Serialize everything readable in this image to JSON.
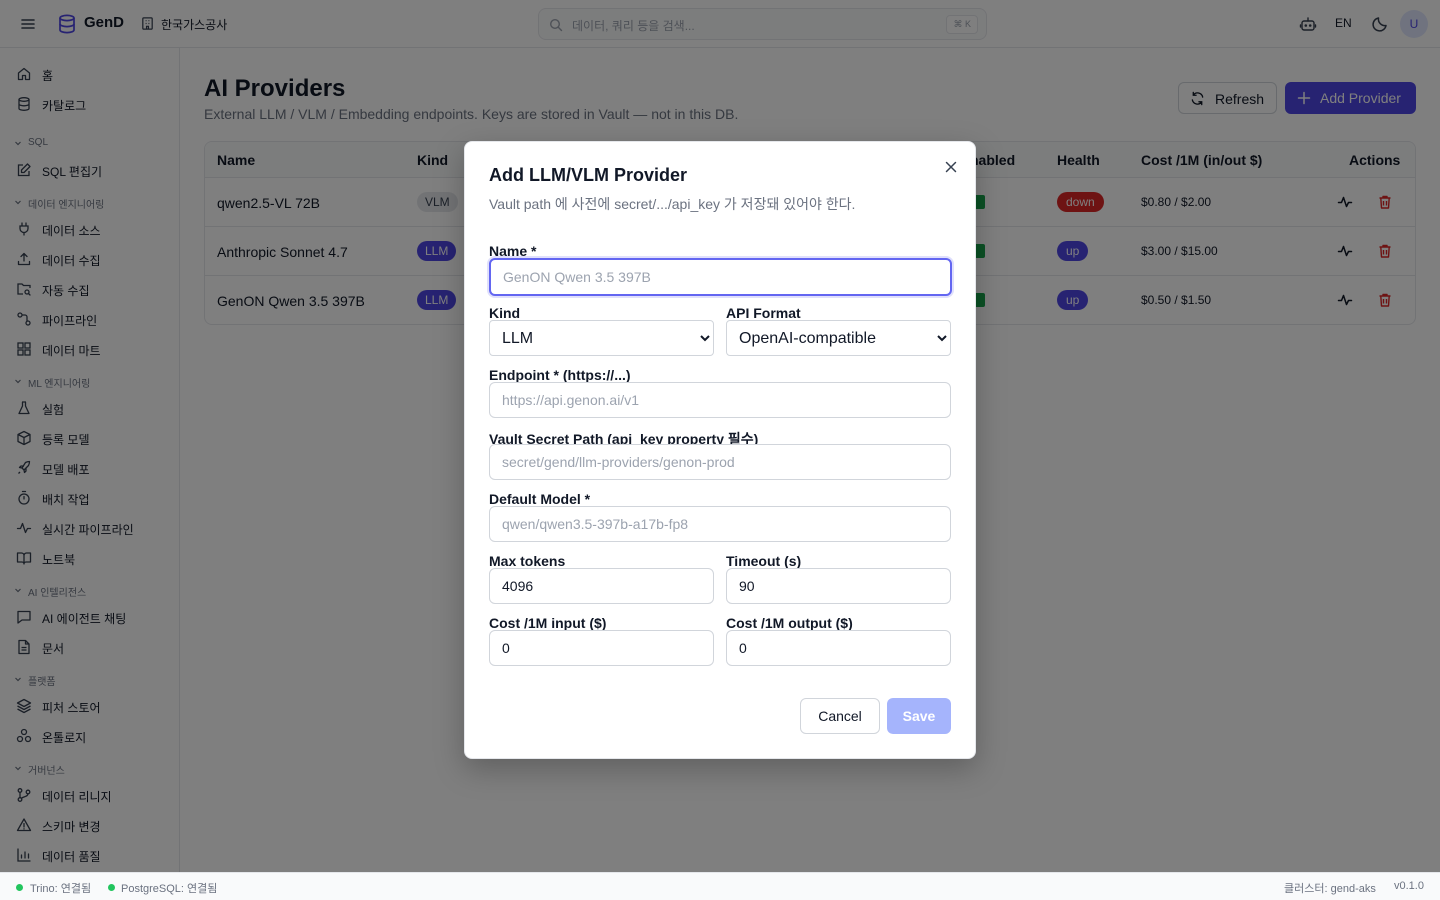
{
  "topbar": {
    "app_name": "GenD",
    "org_name": "한국가스공사",
    "search_placeholder": "데이터, 쿼리 등을 검색...",
    "search_shortcut": "⌘ K",
    "language": "EN",
    "avatar_initial": "U"
  },
  "sidebar": {
    "top_items": [
      {
        "label": "홈",
        "icon": "home-icon"
      },
      {
        "label": "카탈로그",
        "icon": "database-icon"
      }
    ],
    "sections": [
      {
        "title": "SQL",
        "items": [
          {
            "label": "SQL 편집기",
            "icon": "edit-icon"
          }
        ]
      },
      {
        "title": "데이터 엔지니어링",
        "items": [
          {
            "label": "데이터 소스",
            "icon": "plug-icon"
          },
          {
            "label": "데이터 수집",
            "icon": "upload-icon"
          },
          {
            "label": "자동 수집",
            "icon": "folder-search-icon"
          },
          {
            "label": "파이프라인",
            "icon": "workflow-icon"
          },
          {
            "label": "데이터 마트",
            "icon": "grid-icon"
          }
        ]
      },
      {
        "title": "ML 엔지니어링",
        "items": [
          {
            "label": "실험",
            "icon": "flask-icon"
          },
          {
            "label": "등록 모델",
            "icon": "package-icon"
          },
          {
            "label": "모델 배포",
            "icon": "rocket-icon"
          },
          {
            "label": "배치 작업",
            "icon": "timer-icon"
          },
          {
            "label": "실시간 파이프라인",
            "icon": "activity-icon"
          },
          {
            "label": "노트북",
            "icon": "book-icon"
          }
        ]
      },
      {
        "title": "AI 인텔리전스",
        "items": [
          {
            "label": "AI 에이전트 채팅",
            "icon": "chat-icon"
          },
          {
            "label": "문서",
            "icon": "file-icon"
          }
        ]
      },
      {
        "title": "플랫폼",
        "items": [
          {
            "label": "피처 스토어",
            "icon": "layers-icon"
          },
          {
            "label": "온톨로지",
            "icon": "ontology-icon"
          }
        ]
      },
      {
        "title": "거버넌스",
        "items": [
          {
            "label": "데이터 리니지",
            "icon": "git-branch-icon"
          },
          {
            "label": "스키마 변경",
            "icon": "warning-icon"
          },
          {
            "label": "데이터 품질",
            "icon": "bar-chart-icon"
          }
        ]
      }
    ]
  },
  "main": {
    "title": "AI Providers",
    "subtitle": "External LLM / VLM / Embedding endpoints. Keys are stored in Vault — not in this DB.",
    "refresh_label": "Refresh",
    "add_label": "Add Provider",
    "table": {
      "headers": {
        "name": "Name",
        "kind": "Kind",
        "enabled": "nabled",
        "health": "Health",
        "cost": "Cost /1M (in/out $)",
        "actions": "Actions"
      },
      "rows": [
        {
          "name": "qwen2.5-VL 72B",
          "kind": "VLM",
          "health": "down",
          "cost": "$0.80 / $2.00"
        },
        {
          "name": "Anthropic Sonnet 4.7",
          "kind": "LLM",
          "health": "up",
          "cost": "$3.00 / $15.00"
        },
        {
          "name": "GenON Qwen 3.5 397B",
          "kind": "LLM",
          "health": "up",
          "cost": "$0.50 / $1.50"
        }
      ]
    }
  },
  "modal": {
    "title": "Add LLM/VLM Provider",
    "description": "Vault path 에 사전에 secret/.../api_key 가 저장돼 있어야 한다.",
    "name_label": "Name *",
    "name_placeholder": "GenON Qwen 3.5 397B",
    "kind_label": "Kind",
    "kind_value": "LLM",
    "api_format_label": "API Format",
    "api_format_value": "OpenAI-compatible",
    "endpoint_label": "Endpoint * (https://...)",
    "endpoint_placeholder": "https://api.genon.ai/v1",
    "vault_label": "Vault Secret Path (api_key property 필수)",
    "vault_placeholder": "secret/gend/llm-providers/genon-prod",
    "model_label": "Default Model *",
    "model_placeholder": "qwen/qwen3.5-397b-a17b-fp8",
    "max_tokens_label": "Max tokens",
    "max_tokens_value": "4096",
    "timeout_label": "Timeout (s)",
    "timeout_value": "90",
    "cost_in_label": "Cost /1M input ($)",
    "cost_in_value": "0",
    "cost_out_label": "Cost /1M output ($)",
    "cost_out_value": "0",
    "cancel_label": "Cancel",
    "save_label": "Save"
  },
  "statusbar": {
    "trino": "Trino: 연결됨",
    "postgres": "PostgreSQL: 연결됨",
    "cluster": "클러스터: gend-aks",
    "version": "v0.1.0"
  },
  "colors": {
    "accent": "#4f46e5",
    "danger": "#dc2626",
    "success": "#16a34a"
  }
}
